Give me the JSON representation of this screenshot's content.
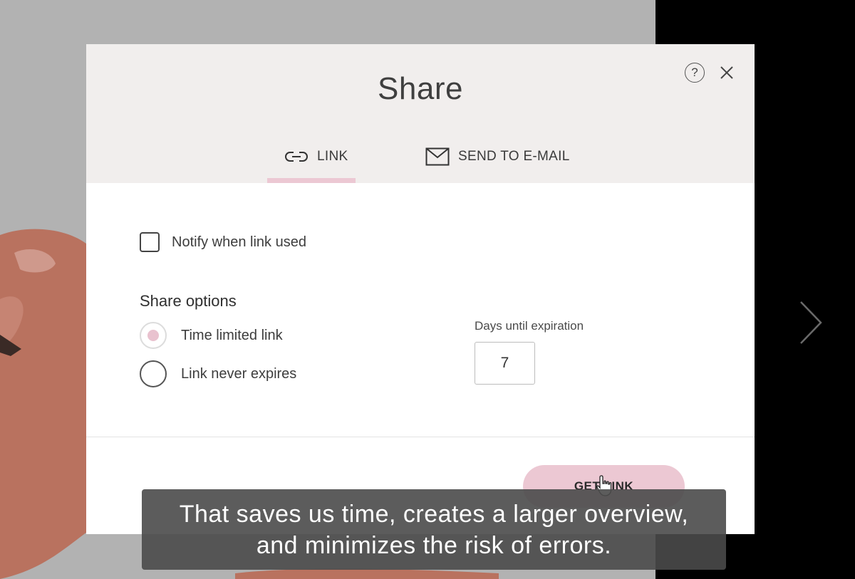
{
  "dialog": {
    "title": "Share",
    "tabs": [
      {
        "label": "LINK",
        "icon": "link-icon",
        "active": true
      },
      {
        "label": "SEND TO E-MAIL",
        "icon": "envelope-icon",
        "active": false
      }
    ],
    "notify_checkbox": {
      "label": "Notify when link used",
      "checked": false
    },
    "share_options": {
      "title": "Share options",
      "options": [
        {
          "label": "Time limited link",
          "selected": true
        },
        {
          "label": "Link never expires",
          "selected": false
        }
      ]
    },
    "expiration": {
      "label": "Days until expiration",
      "value": "7"
    },
    "get_link_label": "GET LINK"
  },
  "caption": {
    "line1": "That saves us time, creates a larger overview,",
    "line2": "and minimizes the risk of errors."
  },
  "colors": {
    "accent": "#ecc8d3",
    "header_bg": "#f1eeed",
    "backdrop": "#b2b2b2"
  }
}
